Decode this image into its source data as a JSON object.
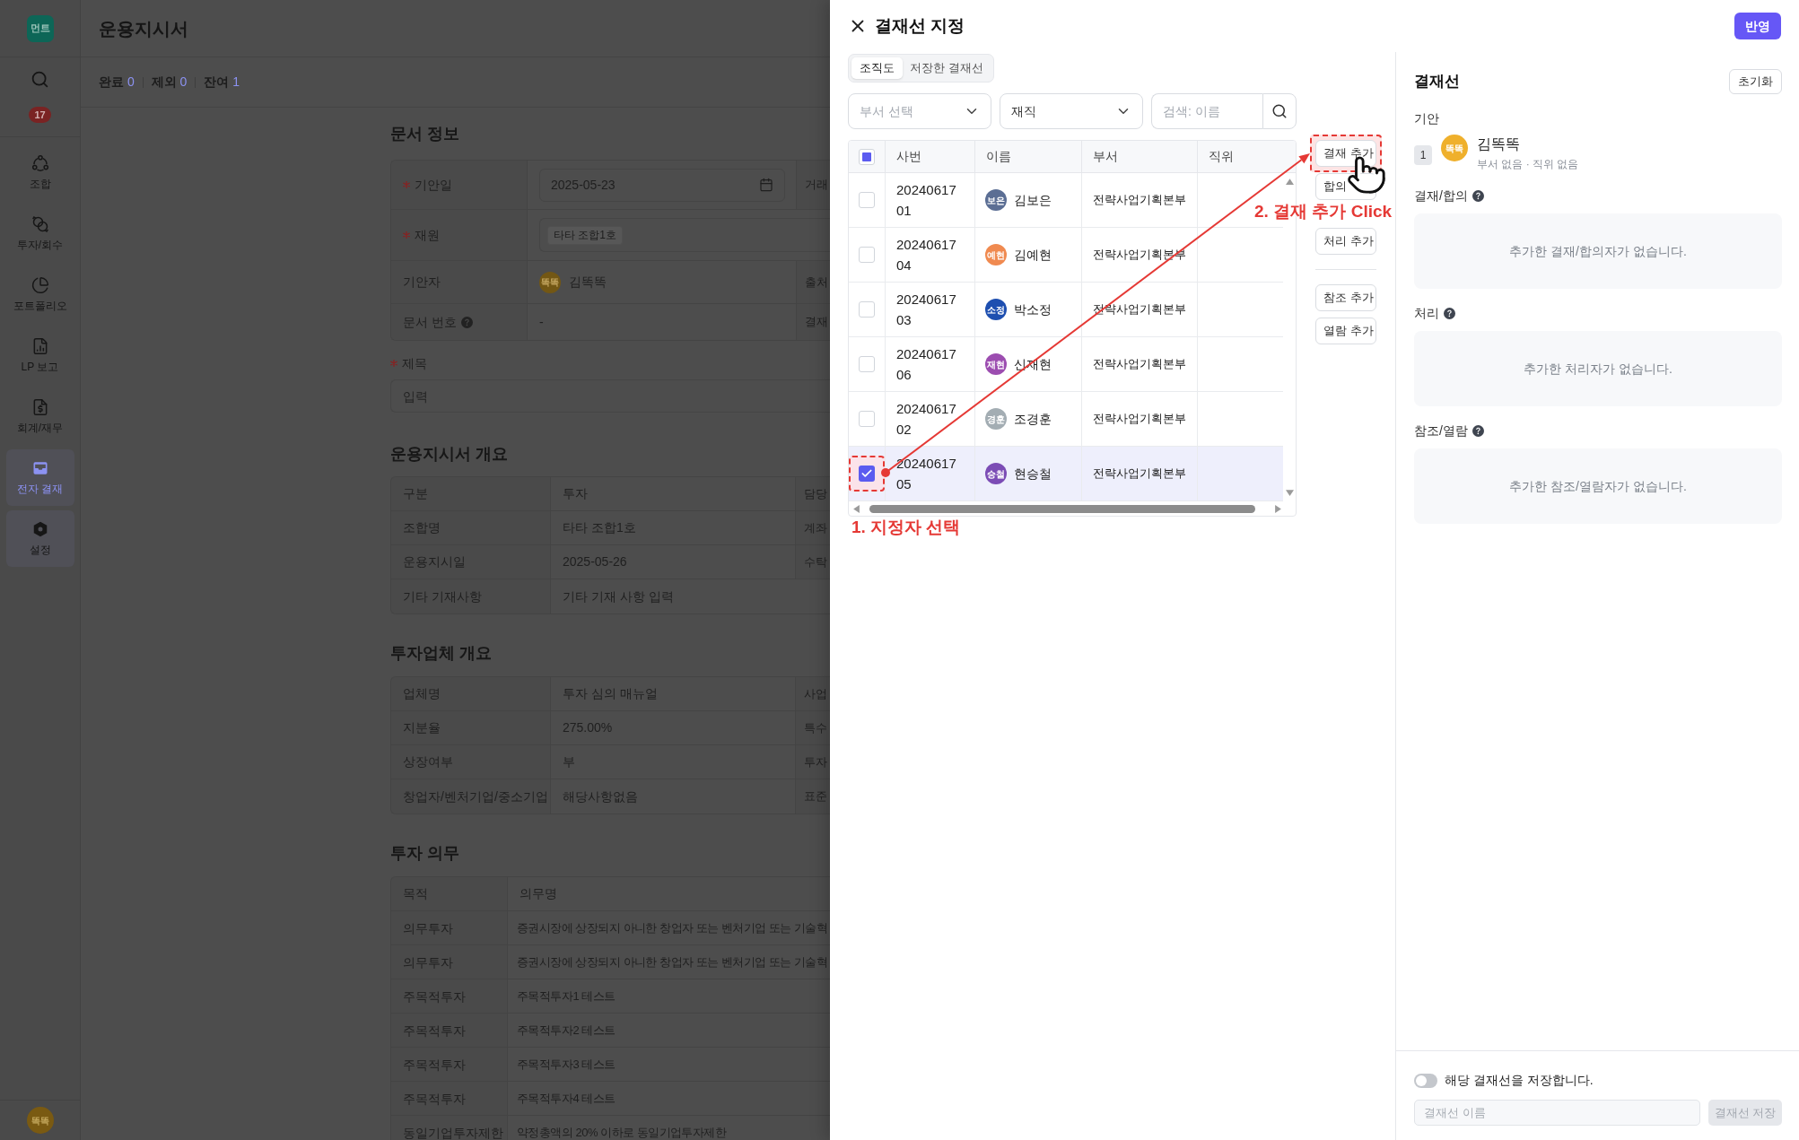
{
  "sidebar": {
    "logo": "먼트",
    "badge": "17",
    "items": [
      {
        "kind": "cycle",
        "label": "조합",
        "selected": false,
        "highlighted": false
      },
      {
        "kind": "exchange",
        "label": "투자/회수",
        "selected": false,
        "highlighted": false
      },
      {
        "kind": "pie",
        "label": "포트폴리오",
        "selected": false,
        "highlighted": false
      },
      {
        "kind": "report",
        "label": "LP 보고",
        "selected": false,
        "highlighted": false
      },
      {
        "kind": "accounting",
        "label": "회계/재무",
        "selected": false,
        "highlighted": false
      },
      {
        "kind": "inbox",
        "label": "전자 결재",
        "selected": true,
        "highlighted": true
      },
      {
        "kind": "settings",
        "label": "설정",
        "selected": false,
        "highlighted": true
      }
    ],
    "user_avatar": "똑똑"
  },
  "page": {
    "title": "운용지시서",
    "stats": [
      {
        "label": "완료",
        "value": "0"
      },
      {
        "label": "제외",
        "value": "0"
      },
      {
        "label": "잔여",
        "value": "1"
      }
    ],
    "document_info": {
      "heading": "문서 정보",
      "rows": [
        {
          "kind": "date",
          "label": "기안일",
          "required": true,
          "help": false,
          "value": "2025-05-23",
          "side_label": "거래"
        },
        {
          "kind": "chip",
          "label": "재원",
          "required": true,
          "help": false,
          "value": "타타 조합1호"
        },
        {
          "kind": "person",
          "label": "기안자",
          "required": false,
          "help": false,
          "avatar": "똑똑",
          "value": "김똑똑",
          "side_label": "출처"
        },
        {
          "kind": "text",
          "label": "문서 번호",
          "required": false,
          "help": true,
          "value": "-",
          "side_label": "결재"
        }
      ],
      "subject": {
        "label": "제목",
        "required": true,
        "placeholder": "입력"
      }
    },
    "summary": {
      "heading": "운용지시서 개요",
      "rows": [
        {
          "label": "구분",
          "value": "투자",
          "side_label": "담당"
        },
        {
          "label": "조합명",
          "value": "타타 조합1호",
          "side_label": "계좌"
        },
        {
          "label": "운용지시일",
          "value": "2025-05-26",
          "side_label": "수탁"
        },
        {
          "label": "기타 기재사항",
          "value": "기타 기재 사항 입력"
        }
      ]
    },
    "company": {
      "heading": "투자업체 개요",
      "rows": [
        {
          "label": "업체명",
          "value": "투자 심의 매뉴얼",
          "side_label": "사업"
        },
        {
          "label": "지분율",
          "value": "275.00%",
          "side_label": "특수"
        },
        {
          "label": "상장여부",
          "value": "부",
          "side_label": "투자"
        },
        {
          "label": "창업자/벤처기업/중소기업",
          "value": "해당사항없음",
          "side_label": "표준"
        }
      ]
    },
    "obligations": {
      "heading": "투자 의무",
      "columns": [
        "목적",
        "의무명"
      ],
      "rows": [
        {
          "purpose": "의무투자",
          "name": "증권시장에 상장되지 아니한 창업자 또는 벤처기업 또는 기술혁"
        },
        {
          "purpose": "의무투자",
          "name": "증권시장에 상장되지 아니한 창업자 또는 벤처기업 또는 기술혁"
        },
        {
          "purpose": "주목적투자",
          "name": "주목적투자1 테스트"
        },
        {
          "purpose": "주목적투자",
          "name": "주목적투자2 테스트"
        },
        {
          "purpose": "주목적투자",
          "name": "주목적투자3 테스트"
        },
        {
          "purpose": "주목적투자",
          "name": "주목적투자4 테스트"
        },
        {
          "purpose": "동일기업투자제한",
          "name": "약정총액의 20% 이하로 동일기업투자제한"
        }
      ]
    }
  },
  "drawer": {
    "title": "결재선 지정",
    "apply_button": "반영",
    "tabs": [
      {
        "label": "조직도",
        "selected": true
      },
      {
        "label": "저장한 결재선",
        "selected": false
      }
    ],
    "department_select": {
      "placeholder": "부서 선택"
    },
    "status_select": {
      "value": "재직"
    },
    "search": {
      "placeholder": "검색: 이름"
    },
    "table": {
      "select_all": {
        "checked": false,
        "indeterminate": true
      },
      "columns": [
        "사번",
        "이름",
        "부서",
        "직위"
      ],
      "rows": [
        {
          "employee_no": "2024061701",
          "avatar": "보은",
          "color": "#5b6e94",
          "name": "김보은",
          "department": "전략사업기획본부",
          "checked": false,
          "highlighted": false
        },
        {
          "employee_no": "2024061704",
          "avatar": "예현",
          "color": "#f08a50",
          "name": "김예현",
          "department": "전략사업기획본부",
          "checked": false,
          "highlighted": false
        },
        {
          "employee_no": "2024061703",
          "avatar": "소정",
          "color": "#1e4fb0",
          "name": "박소정",
          "department": "전략사업기획본부",
          "checked": false,
          "highlighted": false
        },
        {
          "employee_no": "2024061706",
          "avatar": "재현",
          "color": "#9c4db0",
          "name": "신재현",
          "department": "전략사업기획본부",
          "checked": false,
          "highlighted": false
        },
        {
          "employee_no": "2024061702",
          "avatar": "경훈",
          "color": "#a3adb3",
          "name": "조경훈",
          "department": "전략사업기획본부",
          "checked": false,
          "highlighted": false
        },
        {
          "employee_no": "2024061705",
          "avatar": "승철",
          "color": "#7b4cb5",
          "name": "현승철",
          "department": "전략사업기획본부",
          "checked": true,
          "highlighted": true
        }
      ]
    },
    "action_groups": [
      {
        "divided": false,
        "buttons": [
          {
            "label": "결재 추가",
            "highlighted": true
          },
          {
            "label": "합의",
            "highlighted": false
          }
        ]
      },
      {
        "divided": false,
        "buttons": [
          {
            "label": "처리 추가",
            "highlighted": false
          }
        ]
      },
      {
        "divided": true,
        "buttons": [
          {
            "label": "참조 추가",
            "highlighted": false
          },
          {
            "label": "열람 추가",
            "highlighted": false
          }
        ]
      }
    ],
    "annotations": {
      "select_step": "1. 지정자 선택",
      "click_step": "2. 결재 추가 Click"
    }
  },
  "approval_line": {
    "title": "결재선",
    "reset_button": "초기화",
    "drafter": {
      "heading": "기안",
      "order": "1",
      "avatar": "똑똑",
      "name": "김똑똑",
      "meta": "부서 없음 · 직위 없음"
    },
    "groups": [
      {
        "heading": "결재/합의",
        "help": true,
        "empty_text": "추가한 결재/합의자가 없습니다."
      },
      {
        "heading": "처리",
        "help": true,
        "empty_text": "추가한 처리자가 없습니다."
      },
      {
        "heading": "참조/열람",
        "help": true,
        "empty_text": "추가한 참조/열람자가 없습니다."
      }
    ],
    "save": {
      "toggle_label": "해당 결재선을 저장합니다.",
      "on": false,
      "name_placeholder": "결재선 이름",
      "button": "결재선 저장",
      "button_disabled": true
    }
  }
}
